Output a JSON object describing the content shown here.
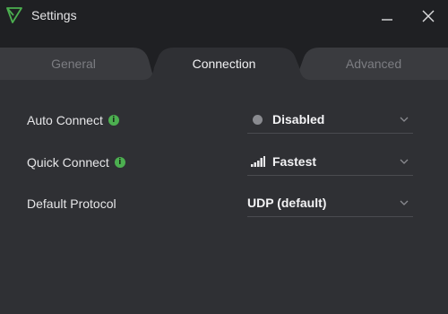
{
  "window": {
    "title": "Settings",
    "minimize_icon": "minimize-icon",
    "close_icon": "close-icon"
  },
  "tabs": [
    {
      "label": "General",
      "active": false
    },
    {
      "label": "Connection",
      "active": true
    },
    {
      "label": "Advanced",
      "active": false
    }
  ],
  "settings": {
    "auto_connect": {
      "label": "Auto Connect",
      "value": "Disabled",
      "icon": "status-dot-icon"
    },
    "quick_connect": {
      "label": "Quick Connect",
      "value": "Fastest",
      "icon": "signal-bars-icon"
    },
    "default_protocol": {
      "label": "Default Protocol",
      "value": "UDP (default)"
    }
  },
  "colors": {
    "accent_green": "#4caf50",
    "titlebar_bg": "#1f2023",
    "content_bg": "#2f3034"
  }
}
